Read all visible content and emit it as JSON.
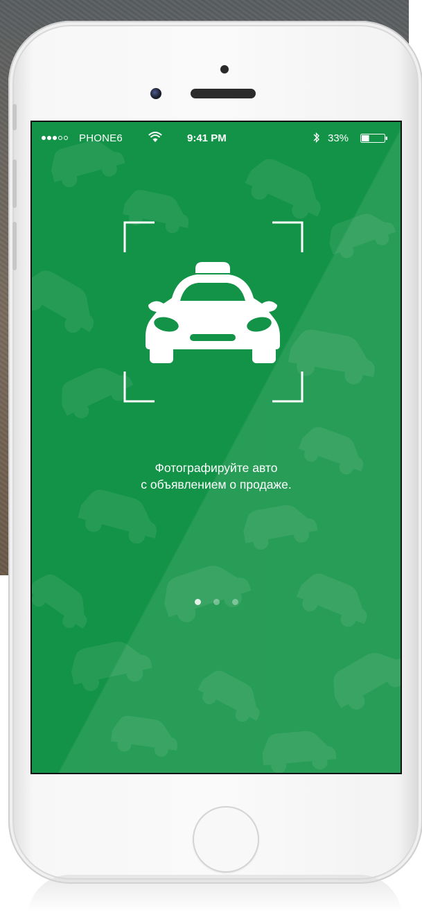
{
  "status_bar": {
    "carrier": "PHONE6",
    "signal_bars_filled": 3,
    "signal_bars_total": 5,
    "time": "9:41 PM",
    "battery_percent": "33%",
    "battery_level": 0.33,
    "icons": [
      "wifi-icon",
      "bluetooth-icon",
      "battery-icon"
    ]
  },
  "onboarding": {
    "line1": "Фотографируйте авто",
    "line2": "с объявлением о продаже.",
    "illustration": "taxi-car-icon",
    "frame": "viewfinder-frame-icon",
    "page_index": 1,
    "page_count": 3
  },
  "colors": {
    "screen_background": "#139347",
    "text": "#ffffff",
    "phone_body": "#f5f5f5"
  }
}
